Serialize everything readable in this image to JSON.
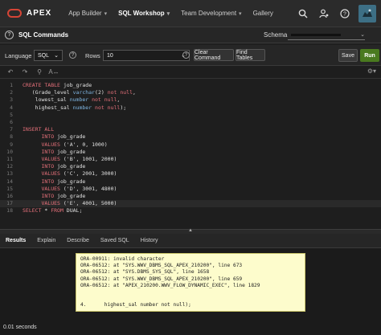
{
  "brand": "APEX",
  "nav": {
    "items": [
      {
        "label": "App Builder",
        "active": false
      },
      {
        "label": "SQL Workshop",
        "active": true
      },
      {
        "label": "Team Development",
        "active": false
      },
      {
        "label": "Gallery",
        "active": false
      }
    ],
    "icons": [
      "search-icon",
      "user-gear-icon",
      "help-icon",
      "avatar"
    ]
  },
  "page": {
    "title": "SQL Commands",
    "schema_label": "Schema"
  },
  "toolbar": {
    "language_label": "Language",
    "language_value": "SQL",
    "rows_label": "Rows",
    "rows_value": "10",
    "clear_label": "Clear Command",
    "find_label": "Find Tables",
    "save_label": "Save",
    "run_label": "Run"
  },
  "editor": {
    "lines": [
      {
        "n": "1",
        "segs": [
          [
            "kw",
            "CREATE TABLE"
          ],
          [
            "nm",
            " job_grade"
          ]
        ]
      },
      {
        "n": "2",
        "segs": [
          [
            "nm",
            "   (Grade_level "
          ],
          [
            "ty",
            "varchar"
          ],
          [
            "nm",
            "(2) "
          ],
          [
            "kw",
            "not null"
          ],
          [
            "nm",
            ","
          ]
        ]
      },
      {
        "n": "3",
        "segs": [
          [
            "nm",
            "    lowest_sal "
          ],
          [
            "ty",
            "number"
          ],
          [
            "nm",
            " "
          ],
          [
            "kw",
            "not null"
          ],
          [
            "nm",
            ","
          ]
        ]
      },
      {
        "n": "4",
        "segs": [
          [
            "nm",
            "    highest_sal "
          ],
          [
            "ty",
            "number"
          ],
          [
            "nm",
            " "
          ],
          [
            "kw",
            "not null"
          ],
          [
            "nm",
            ");"
          ]
        ]
      },
      {
        "n": "5",
        "segs": [
          [
            "nm",
            ""
          ]
        ]
      },
      {
        "n": "6",
        "segs": [
          [
            "nm",
            ""
          ]
        ]
      },
      {
        "n": "7",
        "segs": [
          [
            "kw",
            "INSERT ALL"
          ]
        ]
      },
      {
        "n": "8",
        "segs": [
          [
            "nm",
            "      "
          ],
          [
            "kw",
            "INTO"
          ],
          [
            "nm",
            " job_grade"
          ]
        ]
      },
      {
        "n": "9",
        "segs": [
          [
            "nm",
            "      "
          ],
          [
            "kw",
            "VALUES"
          ],
          [
            "nm",
            " ('A', 0, 1000)"
          ]
        ]
      },
      {
        "n": "10",
        "segs": [
          [
            "nm",
            "      "
          ],
          [
            "kw",
            "INTO"
          ],
          [
            "nm",
            " job_grade"
          ]
        ]
      },
      {
        "n": "11",
        "segs": [
          [
            "nm",
            "      "
          ],
          [
            "kw",
            "VALUES"
          ],
          [
            "nm",
            " ('B', 1001, 2000)"
          ]
        ]
      },
      {
        "n": "12",
        "segs": [
          [
            "nm",
            "      "
          ],
          [
            "kw",
            "INTO"
          ],
          [
            "nm",
            " job_grade"
          ]
        ]
      },
      {
        "n": "13",
        "segs": [
          [
            "nm",
            "      "
          ],
          [
            "kw",
            "VALUES"
          ],
          [
            "nm",
            " ('C', 2001, 3000)"
          ]
        ]
      },
      {
        "n": "14",
        "segs": [
          [
            "nm",
            "      "
          ],
          [
            "kw",
            "INTO"
          ],
          [
            "nm",
            " job_grade"
          ]
        ]
      },
      {
        "n": "15",
        "segs": [
          [
            "nm",
            "      "
          ],
          [
            "kw",
            "VALUES"
          ],
          [
            "nm",
            " ('D', 3001, 4800)"
          ]
        ]
      },
      {
        "n": "16",
        "segs": [
          [
            "nm",
            "      "
          ],
          [
            "kw",
            "INTO"
          ],
          [
            "nm",
            " job_grade"
          ]
        ]
      },
      {
        "n": "17",
        "segs": [
          [
            "nm",
            "      "
          ],
          [
            "kw",
            "VALUES"
          ],
          [
            "nm",
            " ('E', 4001, 5000)"
          ]
        ]
      },
      {
        "n": "18",
        "segs": [
          [
            "kw",
            "SELECT"
          ],
          [
            "nm",
            " * "
          ],
          [
            "kw",
            "FROM"
          ],
          [
            "nm",
            " DUAL;"
          ]
        ]
      }
    ]
  },
  "results": {
    "tabs": [
      {
        "label": "Results",
        "active": true
      },
      {
        "label": "Explain",
        "active": false
      },
      {
        "label": "Describe",
        "active": false
      },
      {
        "label": "Saved SQL",
        "active": false
      },
      {
        "label": "History",
        "active": false
      }
    ],
    "error_lines": [
      "ORA-00911: invalid character",
      "ORA-06512: at \"SYS.WWV_DBMS_SQL_APEX_210200\", line 673",
      "ORA-06512: at \"SYS.DBMS_SYS_SQL\", line 1658",
      "ORA-06512: at \"SYS.WWV_DBMS_SQL_APEX_210200\", line 659",
      "ORA-06512: at \"APEX_210200.WWV_FLOW_DYNAMIC_EXEC\", line 1829",
      "",
      "",
      "4.      highest_sal number not null);"
    ],
    "status": "0.01 seconds"
  },
  "colors": {
    "run_button": "#4a7a1f",
    "logo": "#d64536",
    "error_bg": "#fdfccc",
    "keyword": "#e5707a",
    "type": "#7fb6e3"
  }
}
